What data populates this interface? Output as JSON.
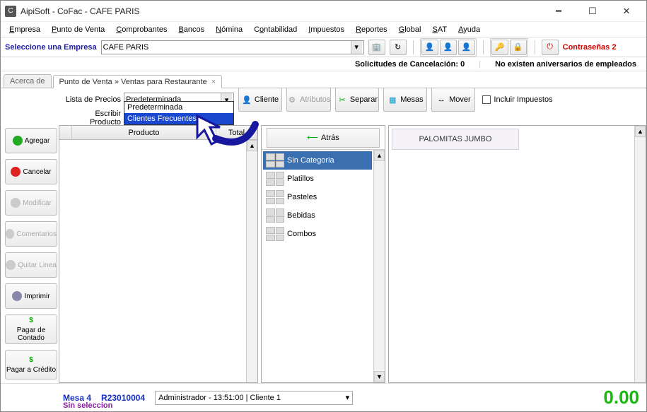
{
  "window": {
    "title": "AipiSoft - CoFac - CAFE PARIS"
  },
  "menu": {
    "items": [
      "Empresa",
      "Punto de Venta",
      "Comprobantes",
      "Bancos",
      "Nómina",
      "Contabilidad",
      "Impuestos",
      "Reportes",
      "Global",
      "SAT",
      "Ayuda"
    ]
  },
  "topstrip": {
    "label": "Seleccione una Empresa",
    "empresa": "CAFE PARIS",
    "contrasenas": "Contraseñas 2"
  },
  "status_line": {
    "solicitudes_label": "Solicitudes de Cancelación:",
    "solicitudes_count": "0",
    "aniversarios": "No existen aniversarios de empleados"
  },
  "tabs": {
    "t0": "Acerca de",
    "t1": "Punto de Venta » Ventas para Restaurante"
  },
  "form": {
    "lista_precios_label": "Lista de Precios",
    "lista_precios_value": "Predeterminada",
    "escribir_prod_label": "Escribir Producto",
    "incluir_impuestos": "Incluir Impuestos"
  },
  "dropdown": {
    "opt0": "Predeterminada",
    "opt1": "Clientes Frecuentes"
  },
  "bigbtns": {
    "cliente": "Cliente",
    "atributos": "Atributos",
    "separar": "Separar",
    "mesas": "Mesas",
    "mover": "Mover"
  },
  "sidebar": {
    "agregar": "Agregar",
    "cancelar": "Cancelar",
    "modificar": "Modificar",
    "comentarios": "Comentarios",
    "quitar": "Quitar Linea",
    "imprimir": "Imprimir",
    "pagar_contado": "Pagar de Contado",
    "pagar_credito": "Pagar a Crédito"
  },
  "grid": {
    "col_producto": "Producto",
    "col_total": "Total"
  },
  "center": {
    "atras": "Atrás",
    "categorias": [
      "Sin Categoria",
      "Platillos",
      "Pasteles",
      "Bebidas",
      "Combos"
    ]
  },
  "right": {
    "producto": "PALOMITAS JUMBO"
  },
  "footer": {
    "mesa": "Mesa 4",
    "folio": "R23010004",
    "admin": "Administrador - 13:51:00 | Cliente 1",
    "total": "0.00",
    "seleccion": "Sin seleccion"
  }
}
